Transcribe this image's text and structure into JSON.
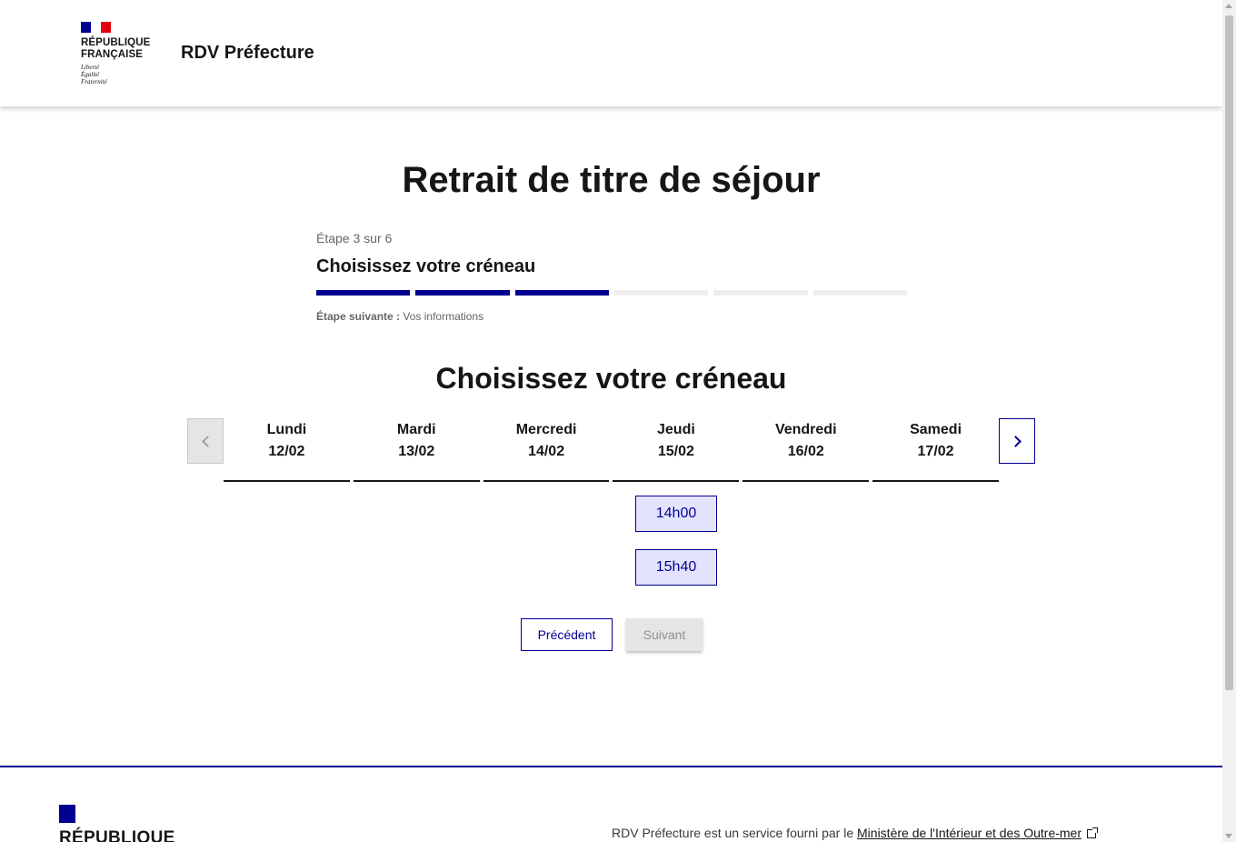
{
  "header": {
    "logo_lines": [
      "RÉPUBLIQUE",
      "FRANÇAISE"
    ],
    "motto": [
      "Liberté",
      "Égalité",
      "Fraternité"
    ],
    "service_name": "RDV Préfecture"
  },
  "page_title": "Retrait de titre de séjour",
  "stepper": {
    "state": "Étape 3 sur 6",
    "title": "Choisissez votre créneau",
    "current_step": 3,
    "total_steps": 6,
    "next_label": "Étape suivante :",
    "next_value": "Vos informations"
  },
  "section_title": "Choisissez votre créneau",
  "calendar": {
    "prev_icon": "chevron-left-icon",
    "next_icon": "chevron-right-icon",
    "days": [
      {
        "name": "Lundi",
        "date": "12/02"
      },
      {
        "name": "Mardi",
        "date": "13/02"
      },
      {
        "name": "Mercredi",
        "date": "14/02"
      },
      {
        "name": "Jeudi",
        "date": "15/02"
      },
      {
        "name": "Vendredi",
        "date": "16/02"
      },
      {
        "name": "Samedi",
        "date": "17/02"
      }
    ],
    "slots": [
      "14h00",
      "15h40"
    ]
  },
  "actions": {
    "previous": "Précédent",
    "next": "Suivant"
  },
  "footer": {
    "brand": "RÉPUBLIQUE",
    "text": "RDV Préfecture est un service fourni par le",
    "link": "Ministère de l'Intérieur et des Outre-mer",
    "link_icon": "external-link-icon"
  },
  "colors": {
    "primary": "#000091",
    "slot_bg": "#e3e3fd",
    "flag_red": "#e1000f",
    "disabled_bg": "#e5e5e5"
  }
}
